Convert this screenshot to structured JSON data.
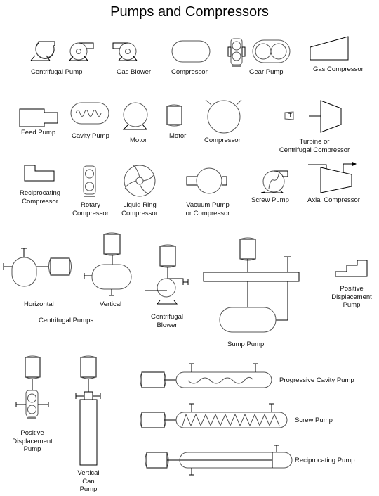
{
  "title": "Pumps and Compressors",
  "symbols": {
    "centrifugal_pump": "Centrifugal Pump",
    "gas_blower": "Gas Blower",
    "compressor_1": "Compressor",
    "gear_pump": "Gear Pump",
    "gas_compressor": "Gas Compressor",
    "feed_pump": "Feed Pump",
    "cavity_pump": "Cavity Pump",
    "motor_1": "Motor",
    "motor_2": "Motor",
    "compressor_2": "Compressor",
    "turbine_line1": "Turbine or",
    "turbine_line2": "Centrifugal Compressor",
    "recip_comp_line1": "Reciprocating",
    "recip_comp_line2": "Compressor",
    "rotary_line1": "Rotary",
    "rotary_line2": "Compressor",
    "liquid_ring_line1": "Liquid Ring",
    "liquid_ring_line2": "Compressor",
    "vacuum_line1": "Vacuum Pump",
    "vacuum_line2": "or Compressor",
    "screw_pump_1": "Screw Pump",
    "axial_compressor": "Axial Compressor",
    "horizontal": "Horizontal",
    "vertical": "Vertical",
    "centrifugal_pumps_group": "Centrifugal Pumps",
    "centrifugal_blower_line1": "Centrifugal",
    "centrifugal_blower_line2": "Blower",
    "sump_pump": "Sump Pump",
    "pd_pump_1_line1": "Positive",
    "pd_pump_1_line2": "Displacement",
    "pd_pump_1_line3": "Pump",
    "pd_pump_2_line1": "Positive",
    "pd_pump_2_line2": "Displacement",
    "pd_pump_2_line3": "Pump",
    "vcan_line1": "Vertical",
    "vcan_line2": "Can",
    "vcan_line3": "Pump",
    "progressive_cavity_pump": "Progressive Cavity Pump",
    "screw_pump_2": "Screw Pump",
    "reciprocating_pump": "Reciprocating Pump",
    "turbine_glyph": "T"
  }
}
